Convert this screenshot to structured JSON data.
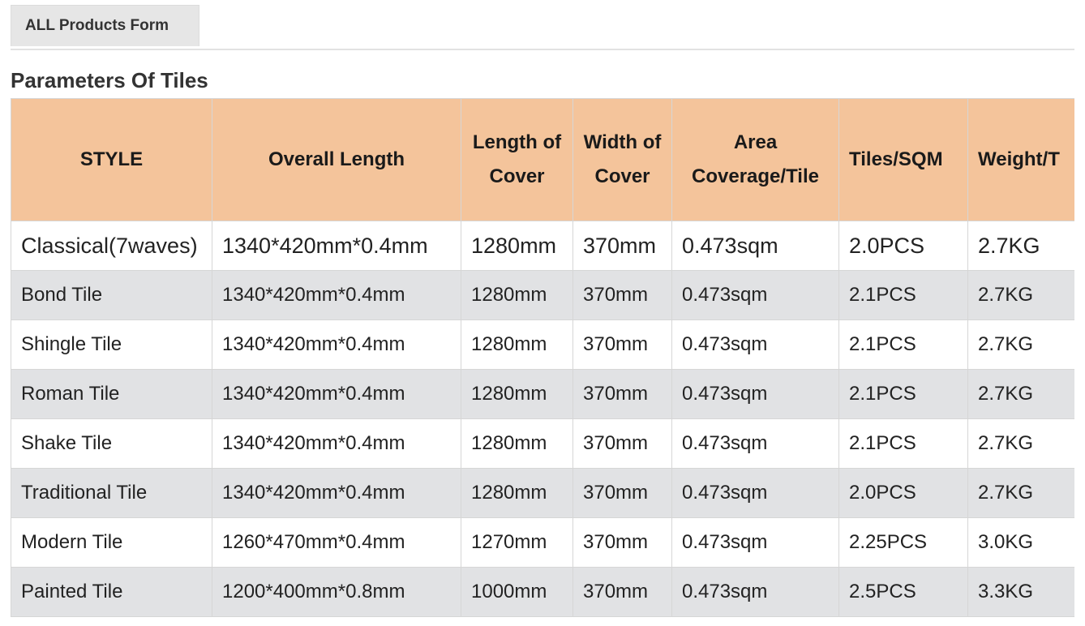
{
  "tabs": [
    {
      "label": "ALL Products Form"
    }
  ],
  "section": {
    "title": "Parameters Of Tiles"
  },
  "table": {
    "headers": [
      "STYLE",
      "Overall Length",
      "Length of Cover",
      "Width of Cover",
      "Area Coverage/Tile",
      "Tiles/SQM",
      "Weight/T"
    ],
    "rows": [
      [
        "Classical(7waves)",
        "1340*420mm*0.4mm",
        "1280mm",
        "370mm",
        "0.473sqm",
        "2.0PCS",
        "2.7KG"
      ],
      [
        "Bond Tile",
        "1340*420mm*0.4mm",
        "1280mm",
        "370mm",
        "0.473sqm",
        "2.1PCS",
        "2.7KG"
      ],
      [
        "Shingle Tile",
        "1340*420mm*0.4mm",
        "1280mm",
        "370mm",
        "0.473sqm",
        "2.1PCS",
        "2.7KG"
      ],
      [
        "Roman Tile",
        "1340*420mm*0.4mm",
        "1280mm",
        "370mm",
        "0.473sqm",
        "2.1PCS",
        "2.7KG"
      ],
      [
        "Shake Tile",
        "1340*420mm*0.4mm",
        "1280mm",
        "370mm",
        "0.473sqm",
        "2.1PCS",
        "2.7KG"
      ],
      [
        "Traditional Tile",
        "1340*420mm*0.4mm",
        "1280mm",
        "370mm",
        "0.473sqm",
        "2.0PCS",
        "2.7KG"
      ],
      [
        "Modern Tile",
        "1260*470mm*0.4mm",
        "1270mm",
        "370mm",
        "0.473sqm",
        "2.25PCS",
        "3.0KG"
      ],
      [
        "Painted Tile",
        "1200*400mm*0.8mm",
        "1000mm",
        "370mm",
        "0.473sqm",
        "2.5PCS",
        "3.3KG"
      ]
    ]
  },
  "colors": {
    "header_bg": "#f4c49b",
    "row_alt_bg": "#e1e2e4",
    "tab_bg": "#e6e6e6"
  }
}
